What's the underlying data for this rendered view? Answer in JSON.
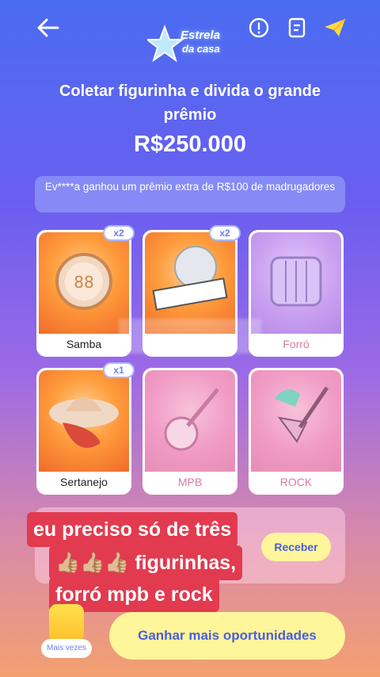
{
  "header": {
    "logo_text_line1": "Estrela",
    "logo_text_line2": "da casa"
  },
  "main": {
    "title": "Coletar figurinha e divida o grande prêmio",
    "prize": "R$250.000",
    "notice": "Ev****a ganhou um prêmio extra de R$100 de madrugadores"
  },
  "cards": [
    {
      "label": "Samba",
      "badge": "x2",
      "state": "collected"
    },
    {
      "label": "",
      "badge": "x2",
      "state": "collected"
    },
    {
      "label": "Forró",
      "badge": "",
      "state": "missing"
    },
    {
      "label": "Sertanejo",
      "badge": "x1",
      "state": "collected"
    },
    {
      "label": "MPB",
      "badge": "",
      "state": "missing"
    },
    {
      "label": "ROCK",
      "badge": "",
      "state": "missing"
    }
  ],
  "actions": {
    "receive": "Receber",
    "more_chances": "Ganhar mais oportunidades",
    "more_times": "Mais vezes"
  },
  "overlay_caption": {
    "line1": "eu preciso só de três",
    "line2": "👍🏼👍🏼👍🏼 figurinhas,",
    "line3": "forró mpb e rock"
  },
  "icons": [
    "back-arrow-icon",
    "info-icon",
    "notes-icon",
    "send-icon",
    "logo-star-icon"
  ]
}
